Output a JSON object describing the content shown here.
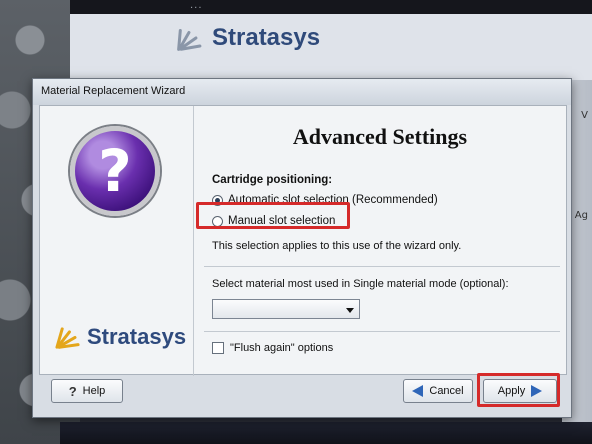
{
  "background": {
    "top_text": "...",
    "logo_text": "Stratasys",
    "right_texts": [
      "V",
      "Ag"
    ]
  },
  "dialog": {
    "title": "Material Replacement Wizard",
    "heading": "Advanced Settings",
    "brand_text": "Stratasys",
    "question_glyph": "?",
    "cartridge": {
      "label": "Cartridge positioning:",
      "option_auto": "Automatic slot selection (Recommended)",
      "option_manual": "Manual slot selection",
      "selected": "auto",
      "note": "This selection applies to this use of the wizard only."
    },
    "material": {
      "label": "Select material most used in Single material mode (optional):",
      "value": ""
    },
    "flush": {
      "label": "\"Flush again\" options",
      "checked": false
    },
    "buttons": {
      "help": "Help",
      "cancel": "Cancel",
      "apply": "Apply"
    }
  },
  "colors": {
    "highlight": "#d52a2a",
    "brand_blue": "#2e4a7d",
    "brand_orange": "#e4a61c",
    "arrow_blue": "#2f66b8"
  },
  "icons": [
    "question-icon",
    "help-icon",
    "back-arrow-icon",
    "next-arrow-icon",
    "dropdown-arrow-icon",
    "stratasys-logo-icon"
  ]
}
